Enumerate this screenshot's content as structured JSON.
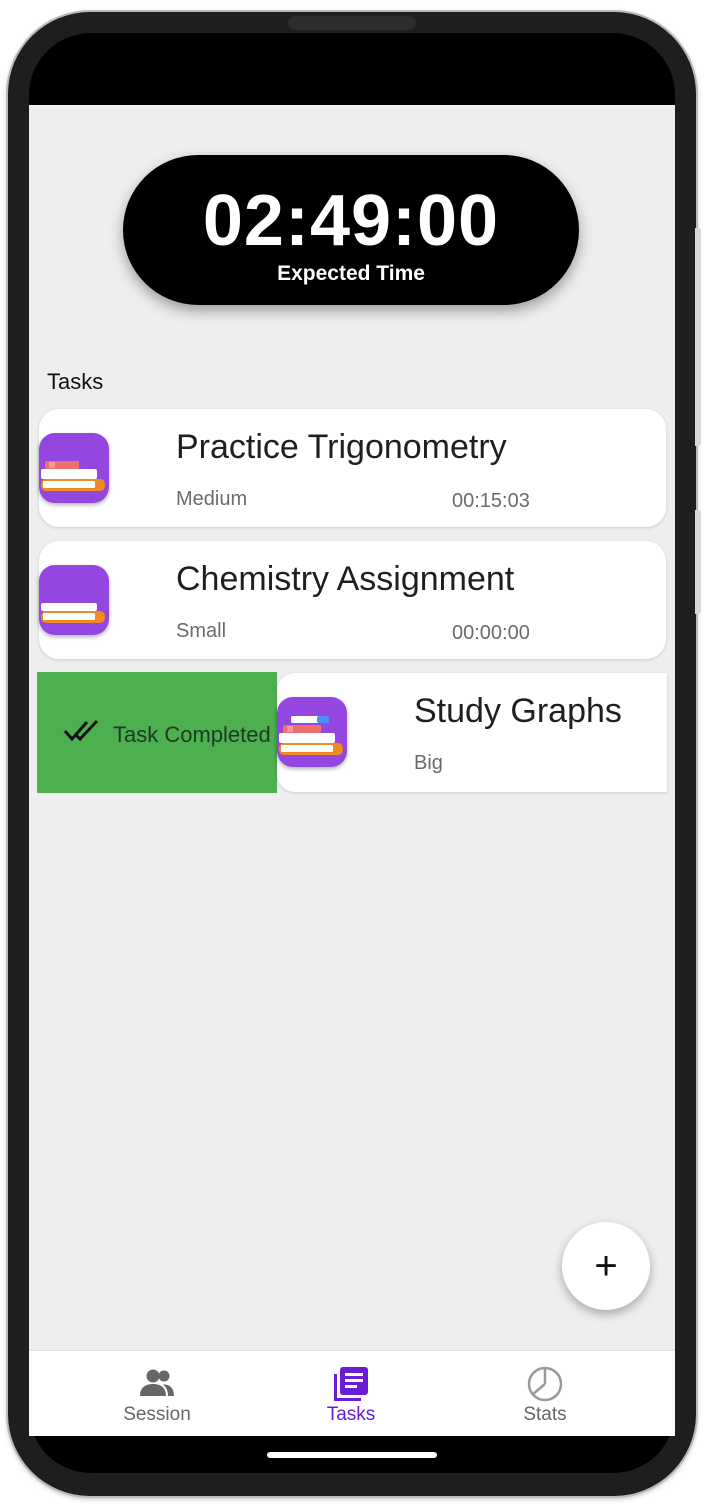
{
  "timer": {
    "value": "02:49:00",
    "label": "Expected Time"
  },
  "tasks_section": {
    "title": "Tasks"
  },
  "tasks": [
    {
      "title": "Practice Trigonometry",
      "size": "Medium",
      "time": "00:15:03",
      "icon": "books-icon"
    },
    {
      "title": "Chemistry Assignment",
      "size": "Small",
      "time": "00:00:00",
      "icon": "books-icon"
    },
    {
      "title": "Study Graphs",
      "size": "Big",
      "icon": "books-icon"
    }
  ],
  "swipe_action": {
    "label": "Task Completed",
    "color": "#4caf50",
    "icon": "double-check-icon"
  },
  "fab": {
    "label": "+",
    "icon": "add-icon"
  },
  "bottom_nav": {
    "active_color": "#6a1cd6",
    "inactive_color": "#666666",
    "items": [
      {
        "label": "Session",
        "icon": "people-icon",
        "active": false
      },
      {
        "label": "Tasks",
        "icon": "task-list-icon",
        "active": true
      },
      {
        "label": "Stats",
        "icon": "pie-chart-icon",
        "active": false
      }
    ]
  },
  "colors": {
    "icon_background": "#9446e0",
    "screen_background": "#eeeeee"
  }
}
